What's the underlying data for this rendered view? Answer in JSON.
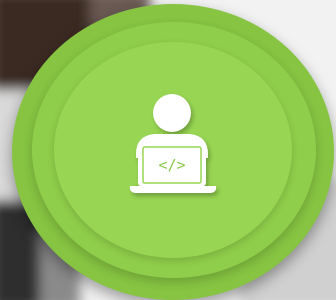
{
  "colors": {
    "background_light": "#f4f4f4",
    "background_dark": "#3b2f2a",
    "ring_outer": "#86c442",
    "ring_mid": "#8fce4a",
    "ring_inner": "#97d552",
    "icon_fill": "#ffffff",
    "code_glyph": "#8cc84b"
  },
  "icon": {
    "name": "developer-laptop-icon",
    "code_glyph_text": "</>"
  }
}
